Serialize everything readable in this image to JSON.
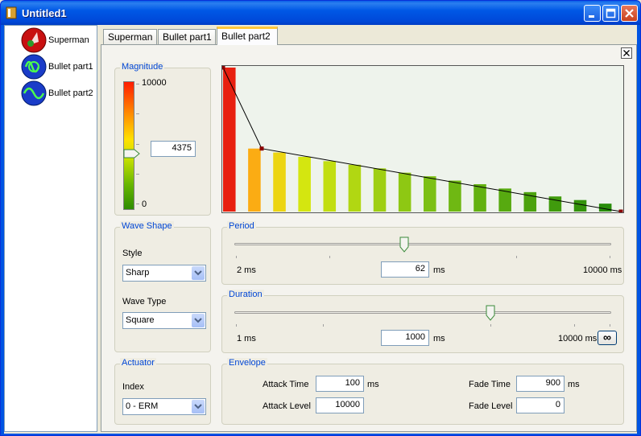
{
  "window": {
    "title": "Untitled1"
  },
  "effects": [
    {
      "label": "Superman",
      "icon": "superman-icon"
    },
    {
      "label": "Bullet part1",
      "icon": "bullet-part1-icon"
    },
    {
      "label": "Bullet part2",
      "icon": "bullet-part2-icon"
    }
  ],
  "tabs": [
    {
      "label": "Superman"
    },
    {
      "label": "Bullet part1"
    },
    {
      "label": "Bullet part2",
      "active": true
    }
  ],
  "magnitude": {
    "title": "Magnitude",
    "max_label": "10000",
    "min_label": "0",
    "value": "4375",
    "level": 0.4375
  },
  "waveshape": {
    "title": "Wave Shape",
    "style_label": "Style",
    "style_value": "Sharp",
    "wavetype_label": "Wave Type",
    "wavetype_value": "Square"
  },
  "actuator": {
    "title": "Actuator",
    "index_label": "Index",
    "index_value": "0 - ERM"
  },
  "period": {
    "title": "Period",
    "min_label": "2 ms",
    "max_label": "10000 ms",
    "value": "62",
    "unit": "ms",
    "slider_level": 0.45
  },
  "duration": {
    "title": "Duration",
    "min_label": "1 ms",
    "max_label": "10000 ms",
    "value": "1000",
    "unit": "ms",
    "slider_level": 0.68,
    "infinite_label": "∞"
  },
  "envelope": {
    "title": "Envelope",
    "attack_time_label": "Attack Time",
    "attack_time": "100",
    "attack_level_label": "Attack Level",
    "attack_level": "10000",
    "fade_time_label": "Fade Time",
    "fade_time": "900",
    "fade_level_label": "Fade Level",
    "fade_level": "0",
    "unit": "ms"
  },
  "colors": {
    "title_bar": "#0054e3",
    "group_title": "#0046d5",
    "active_tab_highlight": "#ffc83c"
  },
  "chart_data": {
    "type": "bar",
    "bar_count": 16,
    "bar_values": [
      10000,
      4375,
      4100,
      3800,
      3500,
      3250,
      3000,
      2700,
      2450,
      2150,
      1900,
      1600,
      1350,
      1050,
      800,
      550
    ],
    "envelope_points": [
      [
        0,
        10000
      ],
      [
        100,
        4375
      ],
      [
        1000,
        0
      ]
    ],
    "ylim": [
      0,
      10000
    ]
  }
}
